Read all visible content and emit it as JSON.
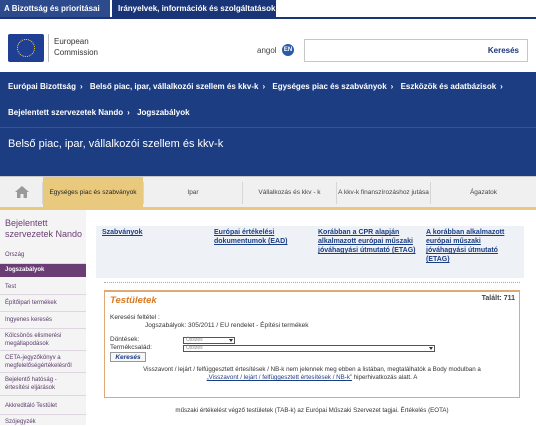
{
  "top_tabs": [
    "A Bizottság és prioritásai",
    "Irányelvek, információk és szolgáltatások"
  ],
  "header": {
    "org_line1": "European",
    "org_line2": "Commission",
    "lang_label": "angol",
    "lang_code": "EN",
    "search_placeholder": "",
    "search_button": "Keresés"
  },
  "breadcrumbs1": [
    "Európai Bizottság",
    "Belső piac, ipar, vállalkozói szellem és kkv-k",
    "Egységes piac és szabványok",
    "Eszközök és adatbázisok"
  ],
  "breadcrumbs2": [
    "Bejelentett szervezetek Nando",
    "Jogszabályok"
  ],
  "page_title": "Belső piac, ipar, vállalkozói szellem és kkv-k",
  "tabs": [
    {
      "label": "Egységes piac és szabványok"
    },
    {
      "label": "Ipar"
    },
    {
      "label": "Vállalkozás és kkv - k"
    },
    {
      "label": "A kkv-k finanszírozáshoz jutása"
    },
    {
      "label": "Ágazatok"
    }
  ],
  "sidebar": {
    "title": "Bejelentett szervezetek Nando",
    "items": [
      "Ország",
      "Jogszabályok",
      "Test",
      "Építőipari termékek",
      "Ingyenes keresés",
      "Kölcsönös elismerési megállapodások",
      "CETA-jegyzőkönyv a megfelelőségértékelésről",
      "Bejelentő hatóság - értesítési eljárások",
      "Akkreditáló Testület",
      "Szójegyzék"
    ]
  },
  "blue_links": [
    "Szabványok",
    "Európai értékelési dokumentumok (EAD)",
    "Korábban a CPR alapján alkalmazott európai műszaki jóváhagyási útmutató (ETAG)",
    "A korábban alkalmazott európai műszaki jóváhagyási útmutató (ETAG)"
  ],
  "result": {
    "title": "Testületek",
    "found": "Talált: 711",
    "criteria_label": "Keresési feltétel :",
    "criteria_value": "Jogszabályok: 305/2011 / EU rendelet - Építési termékek",
    "filter1_label": "Döntések:",
    "filter1_value": "Összes",
    "filter2_label": "Termékcsalád:",
    "filter2_value": "Összes",
    "button": "Keresés",
    "info_text1": "Visszavont / lejárt / felfüggesztett értesítések / NB-k nem jelennek meg ebben a listában, megtalálhatók a Body modulban a",
    "info_link": "„Visszavont / lejárt / felfüggesztett értesítések / NB-k”",
    "info_text2": "hiperhivatkozás alatt. A"
  },
  "footer_text": "műszaki értékelést végző testületek (TAB-k) az Európai Műszaki Szervezet tagjai. Értékelés (EOTA)",
  "colors": {
    "dark_blue": "#1d3d83",
    "gold_tab": "#e9c97e",
    "sidebar_purple": "#6a3d74",
    "orange_title": "#d87a23"
  }
}
